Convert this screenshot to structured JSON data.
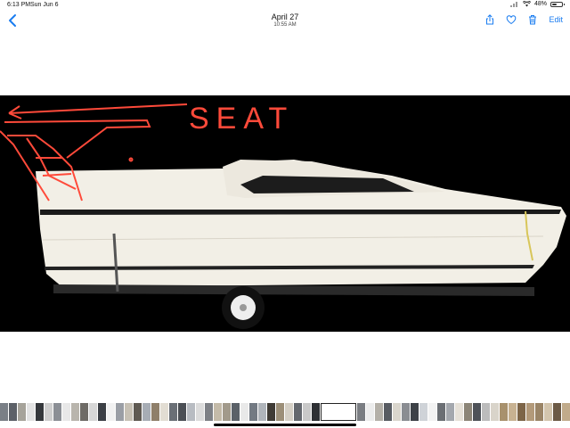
{
  "status_bar": {
    "time": "6:13 PM",
    "date": "Sun Jun 6",
    "battery": "48%",
    "battery_level": 0.48
  },
  "nav": {
    "title": "April 27",
    "subtitle": "10:55 AM",
    "edit_label": "Edit",
    "icons": [
      "chevron-left-icon",
      "share-icon",
      "heart-icon",
      "trash-icon"
    ],
    "accent_color": "#1a7cf0"
  },
  "photo": {
    "annotation_text": "SEAT",
    "annotation_color": "#ff4a3a",
    "subject": "boat-on-trailer"
  },
  "filmstrip": {
    "thumb_colors": [
      "#7a7f86",
      "#5d6168",
      "#a6a39a",
      "#e3e3e3",
      "#35383c",
      "#cfcfcf",
      "#8b8f95",
      "#e8e8e8",
      "#b9b5ad",
      "#6e6b66",
      "#d7d7d7",
      "#3b3f45",
      "#f1f1f1",
      "#9a9ea5",
      "#c7c1b5",
      "#5f5a52",
      "#a7adb5",
      "#8f7f6a",
      "#e2ddd3",
      "#6a6f76",
      "#4b4f55",
      "#b8bcc2",
      "#dcdcdc",
      "#7e8186",
      "#c4bba9",
      "#a29a8b",
      "#5b6168",
      "#e9e9e9",
      "#737a83",
      "#b0b5bb",
      "#3f3b35",
      "#9c8f78",
      "#d5d0c6",
      "#64686e",
      "#c9c9c9",
      "#2e3034",
      "#ffffff",
      "#7a7d82",
      "#ececec",
      "#b4b0a8",
      "#585c62",
      "#dad6cd",
      "#8a8d92",
      "#3d4147",
      "#cfd3d8",
      "#f3f3f3",
      "#6b6f74",
      "#a4a8ae",
      "#e6e1d8",
      "#8c8577",
      "#4e5258",
      "#bcbcbc",
      "#d9d4ca",
      "#a8916d",
      "#c8b292",
      "#7d6548",
      "#b39a7a",
      "#9a8466",
      "#d3c5ad",
      "#6c5a45",
      "#c1ab8b",
      "#8d7455",
      "#e0d2bb",
      "#a38c6c",
      "#5d5043",
      "#cbb699",
      "#92806a",
      "#b8a283",
      "#7a6b58",
      "#d1c0a4"
    ],
    "current_index": 36
  }
}
